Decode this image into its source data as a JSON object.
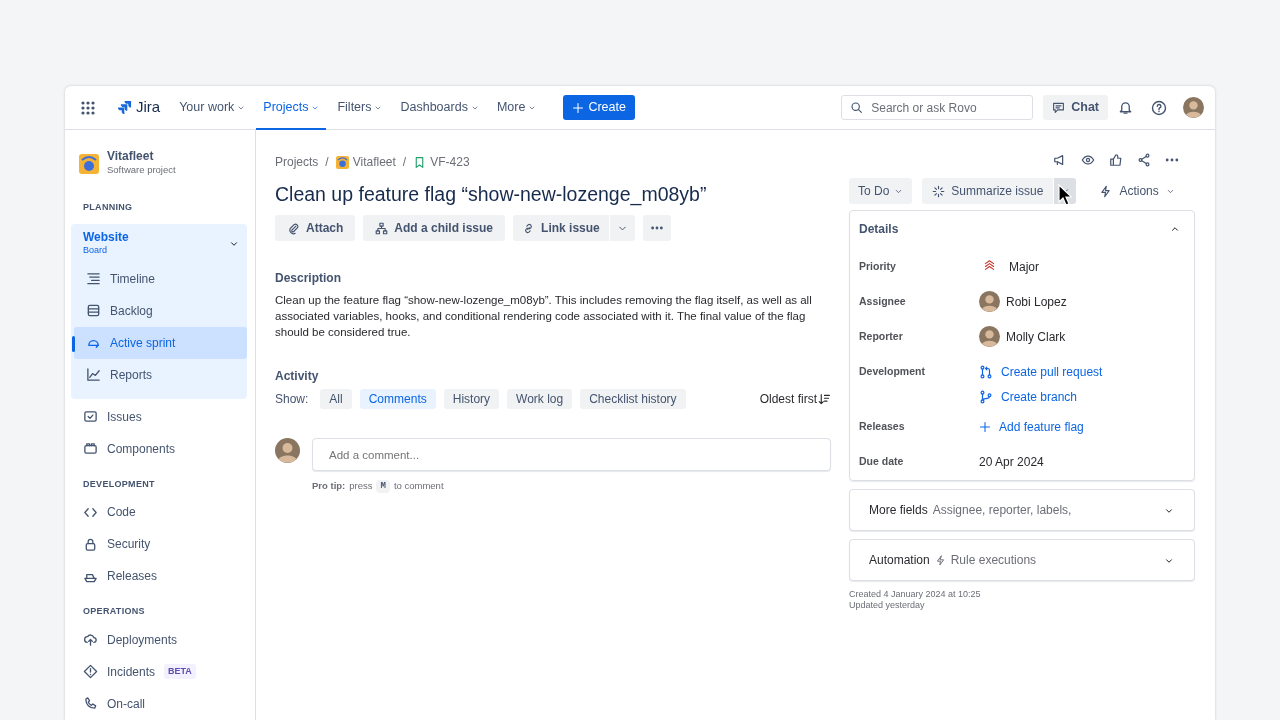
{
  "topnav": {
    "logo": "Jira",
    "items": [
      {
        "label": "Your work",
        "selected": false
      },
      {
        "label": "Projects",
        "selected": true
      },
      {
        "label": "Filters",
        "selected": false
      },
      {
        "label": "Dashboards",
        "selected": false
      },
      {
        "label": "More",
        "selected": false
      }
    ],
    "create": "Create",
    "search": {
      "placeholder": "Search or ask Rovo"
    },
    "chat": "Chat"
  },
  "sidebar": {
    "project": {
      "name": "Vitafleet",
      "type": "Software project"
    },
    "sections": [
      {
        "heading": "PLANNING",
        "board": {
          "name": "Website",
          "subtitle": "Board",
          "expanded": true,
          "items": [
            {
              "label": "Timeline",
              "selected": false
            },
            {
              "label": "Backlog",
              "selected": false
            },
            {
              "label": "Active sprint",
              "selected": true
            },
            {
              "label": "Reports",
              "selected": false
            }
          ]
        },
        "items": [
          {
            "label": "Issues",
            "selected": false
          },
          {
            "label": "Components",
            "selected": false
          }
        ]
      },
      {
        "heading": "DEVELOPMENT",
        "items": [
          {
            "label": "Code",
            "selected": false
          },
          {
            "label": "Security",
            "selected": false
          },
          {
            "label": "Releases",
            "selected": false
          }
        ]
      },
      {
        "heading": "OPERATIONS",
        "items": [
          {
            "label": "Deployments",
            "selected": false
          },
          {
            "label": "Incidents",
            "selected": false,
            "badge": "BETA"
          },
          {
            "label": "On-call",
            "selected": false
          }
        ]
      }
    ]
  },
  "issue": {
    "breadcrumbs": [
      "Projects",
      "Vitafleet",
      "VF-423"
    ],
    "breadcrumb_separator": "/",
    "title": "Clean up feature flag “show-new-lozenge_m08yb”",
    "actions": [
      "Attach",
      "Add a child issue",
      "Link issue"
    ],
    "description": {
      "heading": "Description",
      "text": "Clean up the feature flag “show-new-lozenge_m08yb”. This includes removing the flag itself, as well as all associated variables, hooks, and conditional rendering code associated with it. The final value of the flag should be considered true."
    },
    "activity": {
      "heading": "Activity",
      "show_label": "Show:",
      "filters": [
        {
          "label": "All",
          "selected": false
        },
        {
          "label": "Comments",
          "selected": true
        },
        {
          "label": "History",
          "selected": false
        },
        {
          "label": "Work log",
          "selected": false
        },
        {
          "label": "Checklist history",
          "selected": false
        }
      ],
      "sort": "Oldest first",
      "comment": {
        "placeholder": "Add a comment..."
      },
      "tip": {
        "label": "Pro tip:",
        "before": "press",
        "key": "M",
        "after": "to comment"
      }
    }
  },
  "panel": {
    "status": "To Do",
    "summarize": "Summarize issue",
    "actions": "Actions",
    "details": {
      "title": "Details",
      "expanded": true,
      "fields": [
        {
          "label": "Priority",
          "kind": "priority",
          "values": [
            "Major"
          ]
        },
        {
          "label": "Assignee",
          "kind": "user",
          "values": [
            "Robi Lopez"
          ]
        },
        {
          "label": "Reporter",
          "kind": "user",
          "values": [
            "Molly Clark"
          ]
        },
        {
          "label": "Development",
          "kind": "dev",
          "values": [
            "Create pull request",
            "Create branch"
          ]
        },
        {
          "label": "Releases",
          "kind": "add",
          "values": [
            "Add feature flag"
          ]
        },
        {
          "label": "Due date",
          "kind": "text",
          "values": [
            "20 Apr 2024"
          ]
        }
      ]
    },
    "sections": [
      {
        "title": "More fields",
        "summary": "Assignee, reporter, labels,",
        "kind": "fields"
      },
      {
        "title": "Automation",
        "summary": "Rule executions",
        "kind": "automation"
      }
    ],
    "created": "Created 4 January 2024 at 10:25",
    "updated": "Updated yesterday"
  }
}
